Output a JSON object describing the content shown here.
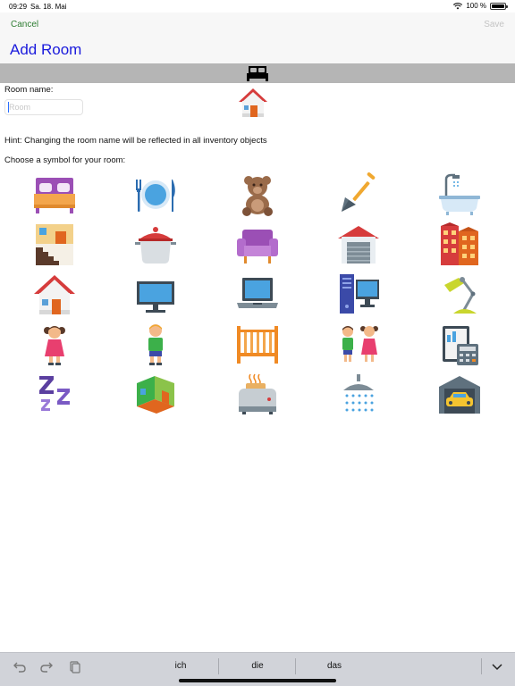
{
  "status_bar": {
    "time": "09:29",
    "date": "Sa. 18. Mai",
    "battery": "100 %"
  },
  "nav": {
    "cancel_label": "Cancel",
    "save_label": "Save",
    "title": "Add Room"
  },
  "form": {
    "room_name_label": "Room name:",
    "room_name_placeholder": "Room",
    "room_name_value": "",
    "hint": "Hint: Changing the room name will be reflected in all inventory objects",
    "symbol_label": "Choose a symbol for your room:"
  },
  "selected_symbol": "house-icon",
  "symbols": [
    "double-bed-icon",
    "dining-plate-icon",
    "teddy-bear-icon",
    "shovel-icon",
    "bathtub-icon",
    "attic-stairs-icon",
    "cooking-pot-icon",
    "sofa-icon",
    "garage-icon",
    "apartment-building-icon",
    "house-icon",
    "monitor-icon",
    "laptop-icon",
    "desktop-computer-icon",
    "desk-lamp-icon",
    "girl-icon",
    "boy-icon",
    "baby-crib-icon",
    "children-icon",
    "calculator-icon",
    "sleep-zzz-icon",
    "room-3d-icon",
    "toaster-icon",
    "shower-icon",
    "car-garage-icon"
  ],
  "keyboard_bar": {
    "suggestions": [
      "ich",
      "die",
      "das"
    ],
    "icons": [
      "undo-icon",
      "redo-icon",
      "paste-icon",
      "hide-keyboard-icon"
    ]
  }
}
